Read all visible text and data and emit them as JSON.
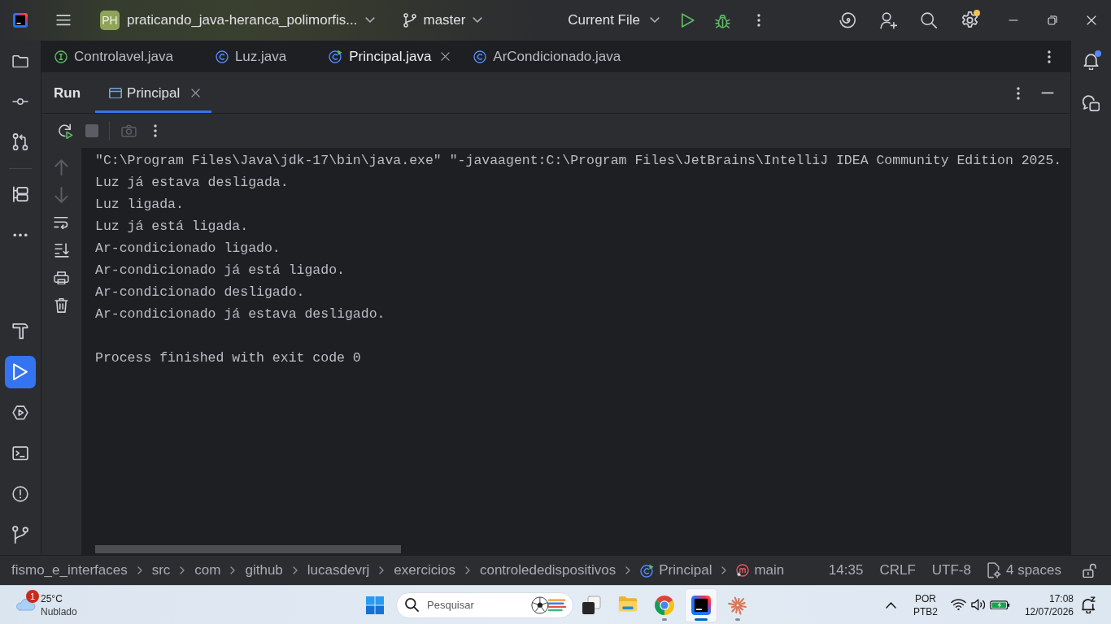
{
  "title_bar": {
    "project": {
      "badge": "PH",
      "name": "praticando_java-heranca_polimorfis..."
    },
    "branch": "master",
    "run_configuration": "Current File",
    "settings_update_available": true
  },
  "tool_strip_left": {
    "top": [
      [
        {
          "kind": "project",
          "selected": false
        },
        {
          "kind": "commit",
          "selected": false
        },
        {
          "kind": "pull_requests",
          "selected": false
        }
      ],
      [
        {
          "kind": "structure",
          "selected": false
        },
        {
          "kind": "more",
          "selected": false
        }
      ]
    ],
    "bottom": [
      {
        "kind": "build",
        "selected": false
      },
      {
        "kind": "run",
        "selected": true
      },
      {
        "kind": "services",
        "selected": false
      },
      {
        "kind": "terminal",
        "selected": false
      },
      {
        "kind": "problems",
        "selected": false
      },
      {
        "kind": "git",
        "selected": false
      }
    ]
  },
  "editor_tabs": [
    {
      "label": "Controlavel.java",
      "kind": "interface",
      "selected": false
    },
    {
      "label": "Luz.java",
      "kind": "class",
      "selected": false
    },
    {
      "label": "Principal.java",
      "kind": "main_class",
      "selected": true
    },
    {
      "label": "ArCondicionado.java",
      "kind": "class",
      "selected": false
    }
  ],
  "tool_strip_right": {
    "notifications_unread": true
  },
  "run_window": {
    "title": "Run",
    "tabs": [
      {
        "label": "Principal",
        "selected": true
      }
    ],
    "toolbar": [
      [
        {
          "kind": "rerun",
          "disabled": false
        },
        {
          "kind": "stop",
          "disabled": true
        }
      ],
      [
        {
          "kind": "screenshot",
          "disabled": true
        },
        {
          "kind": "more",
          "disabled": false
        }
      ]
    ],
    "side_toolbar": [
      {
        "kind": "scroll_up",
        "disabled": true
      },
      {
        "kind": "scroll_down",
        "disabled": true
      },
      {
        "kind": "soft_wrap",
        "disabled": false
      },
      {
        "kind": "scroll_to_end",
        "disabled": false
      },
      {
        "kind": "print",
        "disabled": false
      },
      {
        "kind": "clear",
        "disabled": false
      }
    ],
    "console": {
      "output": [
        "\"C:\\Program Files\\Java\\jdk-17\\bin\\java.exe\" \"-javaagent:C:\\Program Files\\JetBrains\\IntelliJ IDEA Community Edition 2025.",
        "Luz já estava desligada.",
        "Luz ligada.",
        "Luz já está ligada.",
        "Ar-condicionado ligado.",
        "Ar-condicionado já está ligado.",
        "Ar-condicionado desligado.",
        "Ar-condicionado já estava desligado."
      ],
      "exit_message": "Process finished with exit code 0"
    }
  },
  "status_bar": {
    "breadcrumbs": [
      {
        "label": "fismo_e_interfaces",
        "kind": "folder"
      },
      {
        "label": "src",
        "kind": "folder"
      },
      {
        "label": "com",
        "kind": "folder"
      },
      {
        "label": "github",
        "kind": "folder"
      },
      {
        "label": "lucasdevrj",
        "kind": "folder"
      },
      {
        "label": "exercicios",
        "kind": "folder"
      },
      {
        "label": "controlededispositivos",
        "kind": "folder"
      },
      {
        "label": "Principal",
        "kind": "class"
      },
      {
        "label": "main",
        "kind": "method"
      }
    ],
    "caret_position": "14:35",
    "line_separator": "CRLF",
    "encoding": "UTF-8",
    "indent": "4 spaces",
    "read_only": false
  },
  "taskbar": {
    "weather": {
      "badge": "1",
      "temperature": "25°C",
      "condition": "Nublado"
    },
    "search": {
      "placeholder": "Pesquisar"
    },
    "apps": [
      {
        "kind": "task_view",
        "running": false,
        "selected": false
      },
      {
        "kind": "file_explorer",
        "running": false,
        "selected": false
      },
      {
        "kind": "chrome",
        "running": true,
        "selected": false
      },
      {
        "kind": "intellij",
        "running": true,
        "selected": true
      },
      {
        "kind": "claude",
        "running": true,
        "selected": false
      }
    ],
    "input_language": "POR",
    "keyboard_layout": "PTB2",
    "time": "17:08",
    "date": "12/07/2026"
  }
}
